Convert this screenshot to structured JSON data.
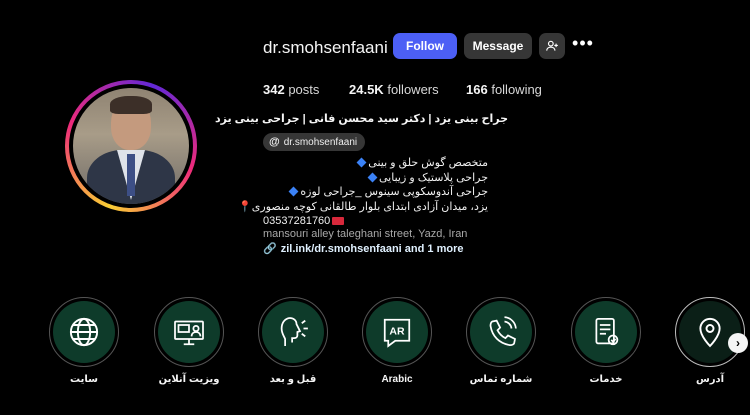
{
  "profile": {
    "username": "dr.smohsenfaani",
    "follow_label": "Follow",
    "message_label": "Message",
    "more_label": "•••",
    "posts_count": "342",
    "posts_label": "posts",
    "followers_count": "24.5K",
    "followers_label": "followers",
    "following_count": "166",
    "following_label": "following",
    "full_name": "جراح بینی یزد | دکتر سید محسن فانی | جراحی بینی یزد",
    "threads_handle": "dr.smohsenfaani",
    "threads_icon": "@",
    "bio_lines": [
      "متخصص گوش حلق و بینی",
      "جراحی پلاستیک و زیبایی",
      "جراحی آندوسکوپی سینوس _جراحی لوزه",
      "یزد، میدان آزادی ابتدای بلوار طالقانی کوچه منصوری"
    ],
    "pin_glyph": "📍",
    "phone": "03537281760",
    "address_en": "mansouri alley taleghani street, Yazd, Iran",
    "link_text": "zil.ink/dr.smohsenfaani and 1 more",
    "link_icon": "🔗"
  },
  "highlights": [
    {
      "label": "سایت",
      "icon": "globe-icon"
    },
    {
      "label": "ویزیت آنلاین",
      "icon": "online-visit-icon"
    },
    {
      "label": "قبل و بعد",
      "icon": "face-profile-icon"
    },
    {
      "label": "Arabic",
      "icon": "ar-badge-icon",
      "badge_text": "AR"
    },
    {
      "label": "شماره تماس",
      "icon": "phone-icon"
    },
    {
      "label": "خدمات",
      "icon": "checklist-icon"
    },
    {
      "label": "آدرس",
      "icon": "location-pin-icon"
    }
  ],
  "next_arrow": "›",
  "colors": {
    "background": "#000000",
    "follow_button": "#4c5ff5",
    "secondary_button": "#363636",
    "highlight_fill": "#0e3b2a",
    "link": "#e0f1ff"
  }
}
